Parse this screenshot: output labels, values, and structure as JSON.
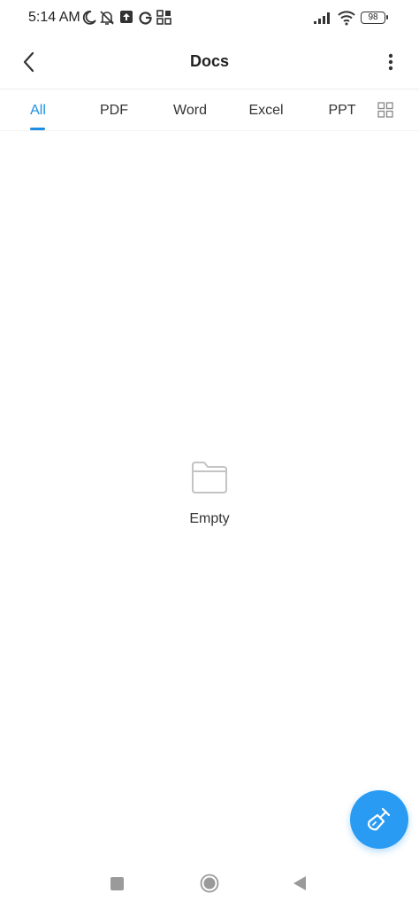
{
  "status_bar": {
    "time": "5:14 AM",
    "battery": "98",
    "icons": [
      "moon-icon",
      "bell-off-icon",
      "upload-icon",
      "google-icon",
      "app-grid-icon",
      "signal-icon",
      "wifi-icon",
      "battery-icon"
    ]
  },
  "app_bar": {
    "title": "Docs",
    "back_icon": "chevron-left-icon",
    "menu_icon": "more-vertical-icon"
  },
  "tabs": {
    "items": [
      "All",
      "PDF",
      "Word",
      "Excel",
      "PPT"
    ],
    "active": "All",
    "view_toggle_icon": "grid-view-icon"
  },
  "empty_state": {
    "icon": "folder-icon",
    "label": "Empty"
  },
  "fab": {
    "icon": "broom-icon",
    "color": "#2a9bf2"
  },
  "nav_bar": {
    "icons": [
      "recents-icon",
      "home-icon",
      "back-icon"
    ]
  },
  "colors": {
    "accent": "#1a8fe3",
    "background": "#ffffff"
  }
}
